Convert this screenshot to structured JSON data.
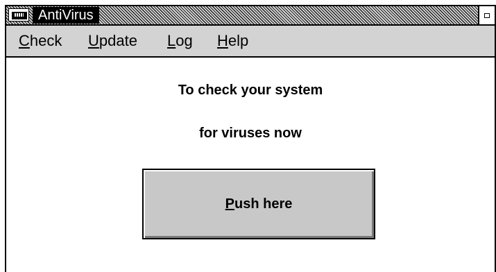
{
  "window": {
    "title": "AntiVirus"
  },
  "menu": {
    "items": [
      {
        "mnemonic": "C",
        "rest": "heck"
      },
      {
        "mnemonic": "U",
        "rest": "pdate"
      },
      {
        "mnemonic": "L",
        "rest": "og"
      },
      {
        "mnemonic": "H",
        "rest": "elp"
      }
    ]
  },
  "content": {
    "line1": "To check your system",
    "line2": "for viruses now"
  },
  "button": {
    "mnemonic": "P",
    "rest": "ush here"
  },
  "icons": {
    "system_menu": "system-menu-icon",
    "minimize": "minimize-icon"
  }
}
